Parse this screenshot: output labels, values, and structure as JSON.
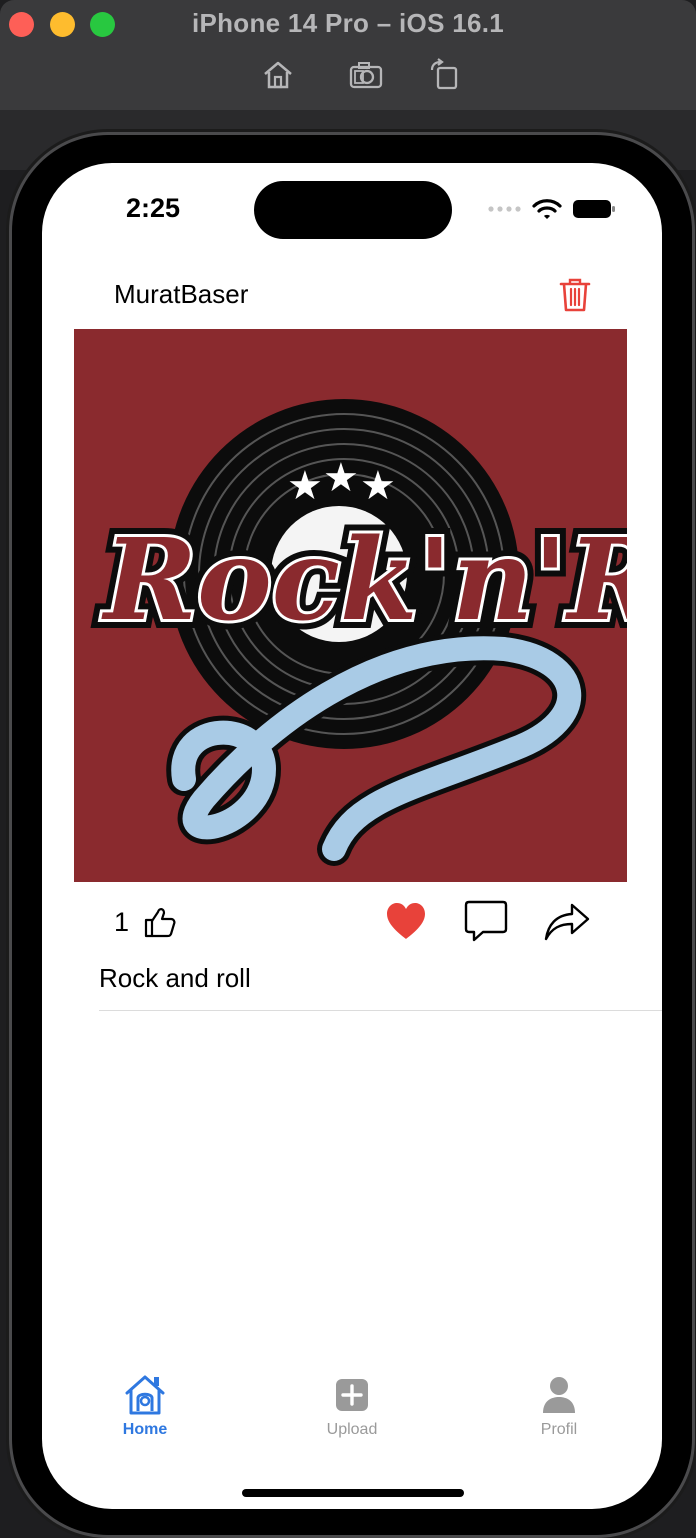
{
  "simulator": {
    "title": "iPhone 14 Pro – iOS 16.1",
    "toolbar": [
      "home-icon",
      "screenshot-icon",
      "rotate-icon"
    ]
  },
  "status_bar": {
    "time": "2:25",
    "icons": [
      "signal-dots-icon",
      "wifi-icon",
      "battery-icon"
    ]
  },
  "post": {
    "username": "MuratBaser",
    "delete_icon": "trash-icon",
    "image": {
      "description_icon": "rock-n-roll-vinyl-logo",
      "logo_text": "Rock'n'Roll",
      "background_color": "#8a2a2e"
    },
    "like_count": "1",
    "actions": [
      "thumbs-up-icon",
      "heart-icon",
      "comment-icon",
      "share-icon"
    ],
    "liked": true,
    "heart_color": "#e8423a",
    "caption": "Rock and roll"
  },
  "tab_bar": {
    "tabs": [
      {
        "label": "Home",
        "icon": "home-icon",
        "active": true
      },
      {
        "label": "Upload",
        "icon": "plus-square-icon",
        "active": false
      },
      {
        "label": "Profil",
        "icon": "person-icon",
        "active": false
      }
    ],
    "active_color": "#2f78e0",
    "inactive_color": "#9a9a9a"
  },
  "colors": {
    "accent": "#2f78e0",
    "trash": "#e8423a",
    "heart": "#e8423a"
  }
}
